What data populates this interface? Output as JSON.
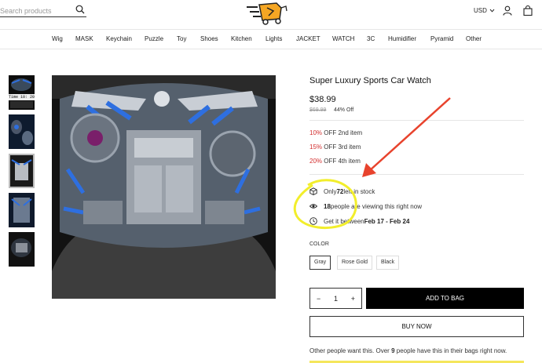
{
  "header": {
    "search_placeholder": "Search products",
    "currency": "USD"
  },
  "nav": [
    "Wig",
    "MASK",
    "Keychain",
    "Puzzle",
    "Toy",
    "Shoes",
    "Kitchen",
    "Lights",
    "JACKET",
    "WATCH",
    "3C",
    "Humidifier",
    "Pyramid",
    "Other"
  ],
  "gallery": {
    "thumb_caption": "Time  10: 20"
  },
  "product": {
    "title": "Super Luxury Sports Car Watch",
    "price": "$38.99",
    "compare_price": "$69.99",
    "discount": "44% Off",
    "tiers": [
      {
        "pct": "10%",
        "text": " OFF 2nd item"
      },
      {
        "pct": "15%",
        "text": " OFF 3rd item"
      },
      {
        "pct": "20%",
        "text": " OFF 4th item"
      }
    ],
    "stock": {
      "pre": "Only ",
      "count": "72",
      "post": " left in stock"
    },
    "viewers": {
      "count": "18",
      "post": " people are viewing this right now"
    },
    "delivery": {
      "pre": "Get it between ",
      "dates": "Feb 17 - Feb 24"
    },
    "color_label": "COLOR",
    "colors": [
      "Gray",
      "Rose Gold",
      "Black"
    ],
    "selected_color": "Gray",
    "quantity": "1",
    "add_to_bag": "ADD TO BAG",
    "buy_now": "BUY NOW",
    "social": {
      "pre": "Other people want this. Over ",
      "count": "9",
      "post": " people have this in their bags right now."
    }
  },
  "colors": {
    "accent_red": "#d32f2f",
    "annotation_arrow": "#e8432d",
    "annotation_circle": "#f2ee2c",
    "button_black": "#000000",
    "logo_orange": "#f5a623"
  }
}
